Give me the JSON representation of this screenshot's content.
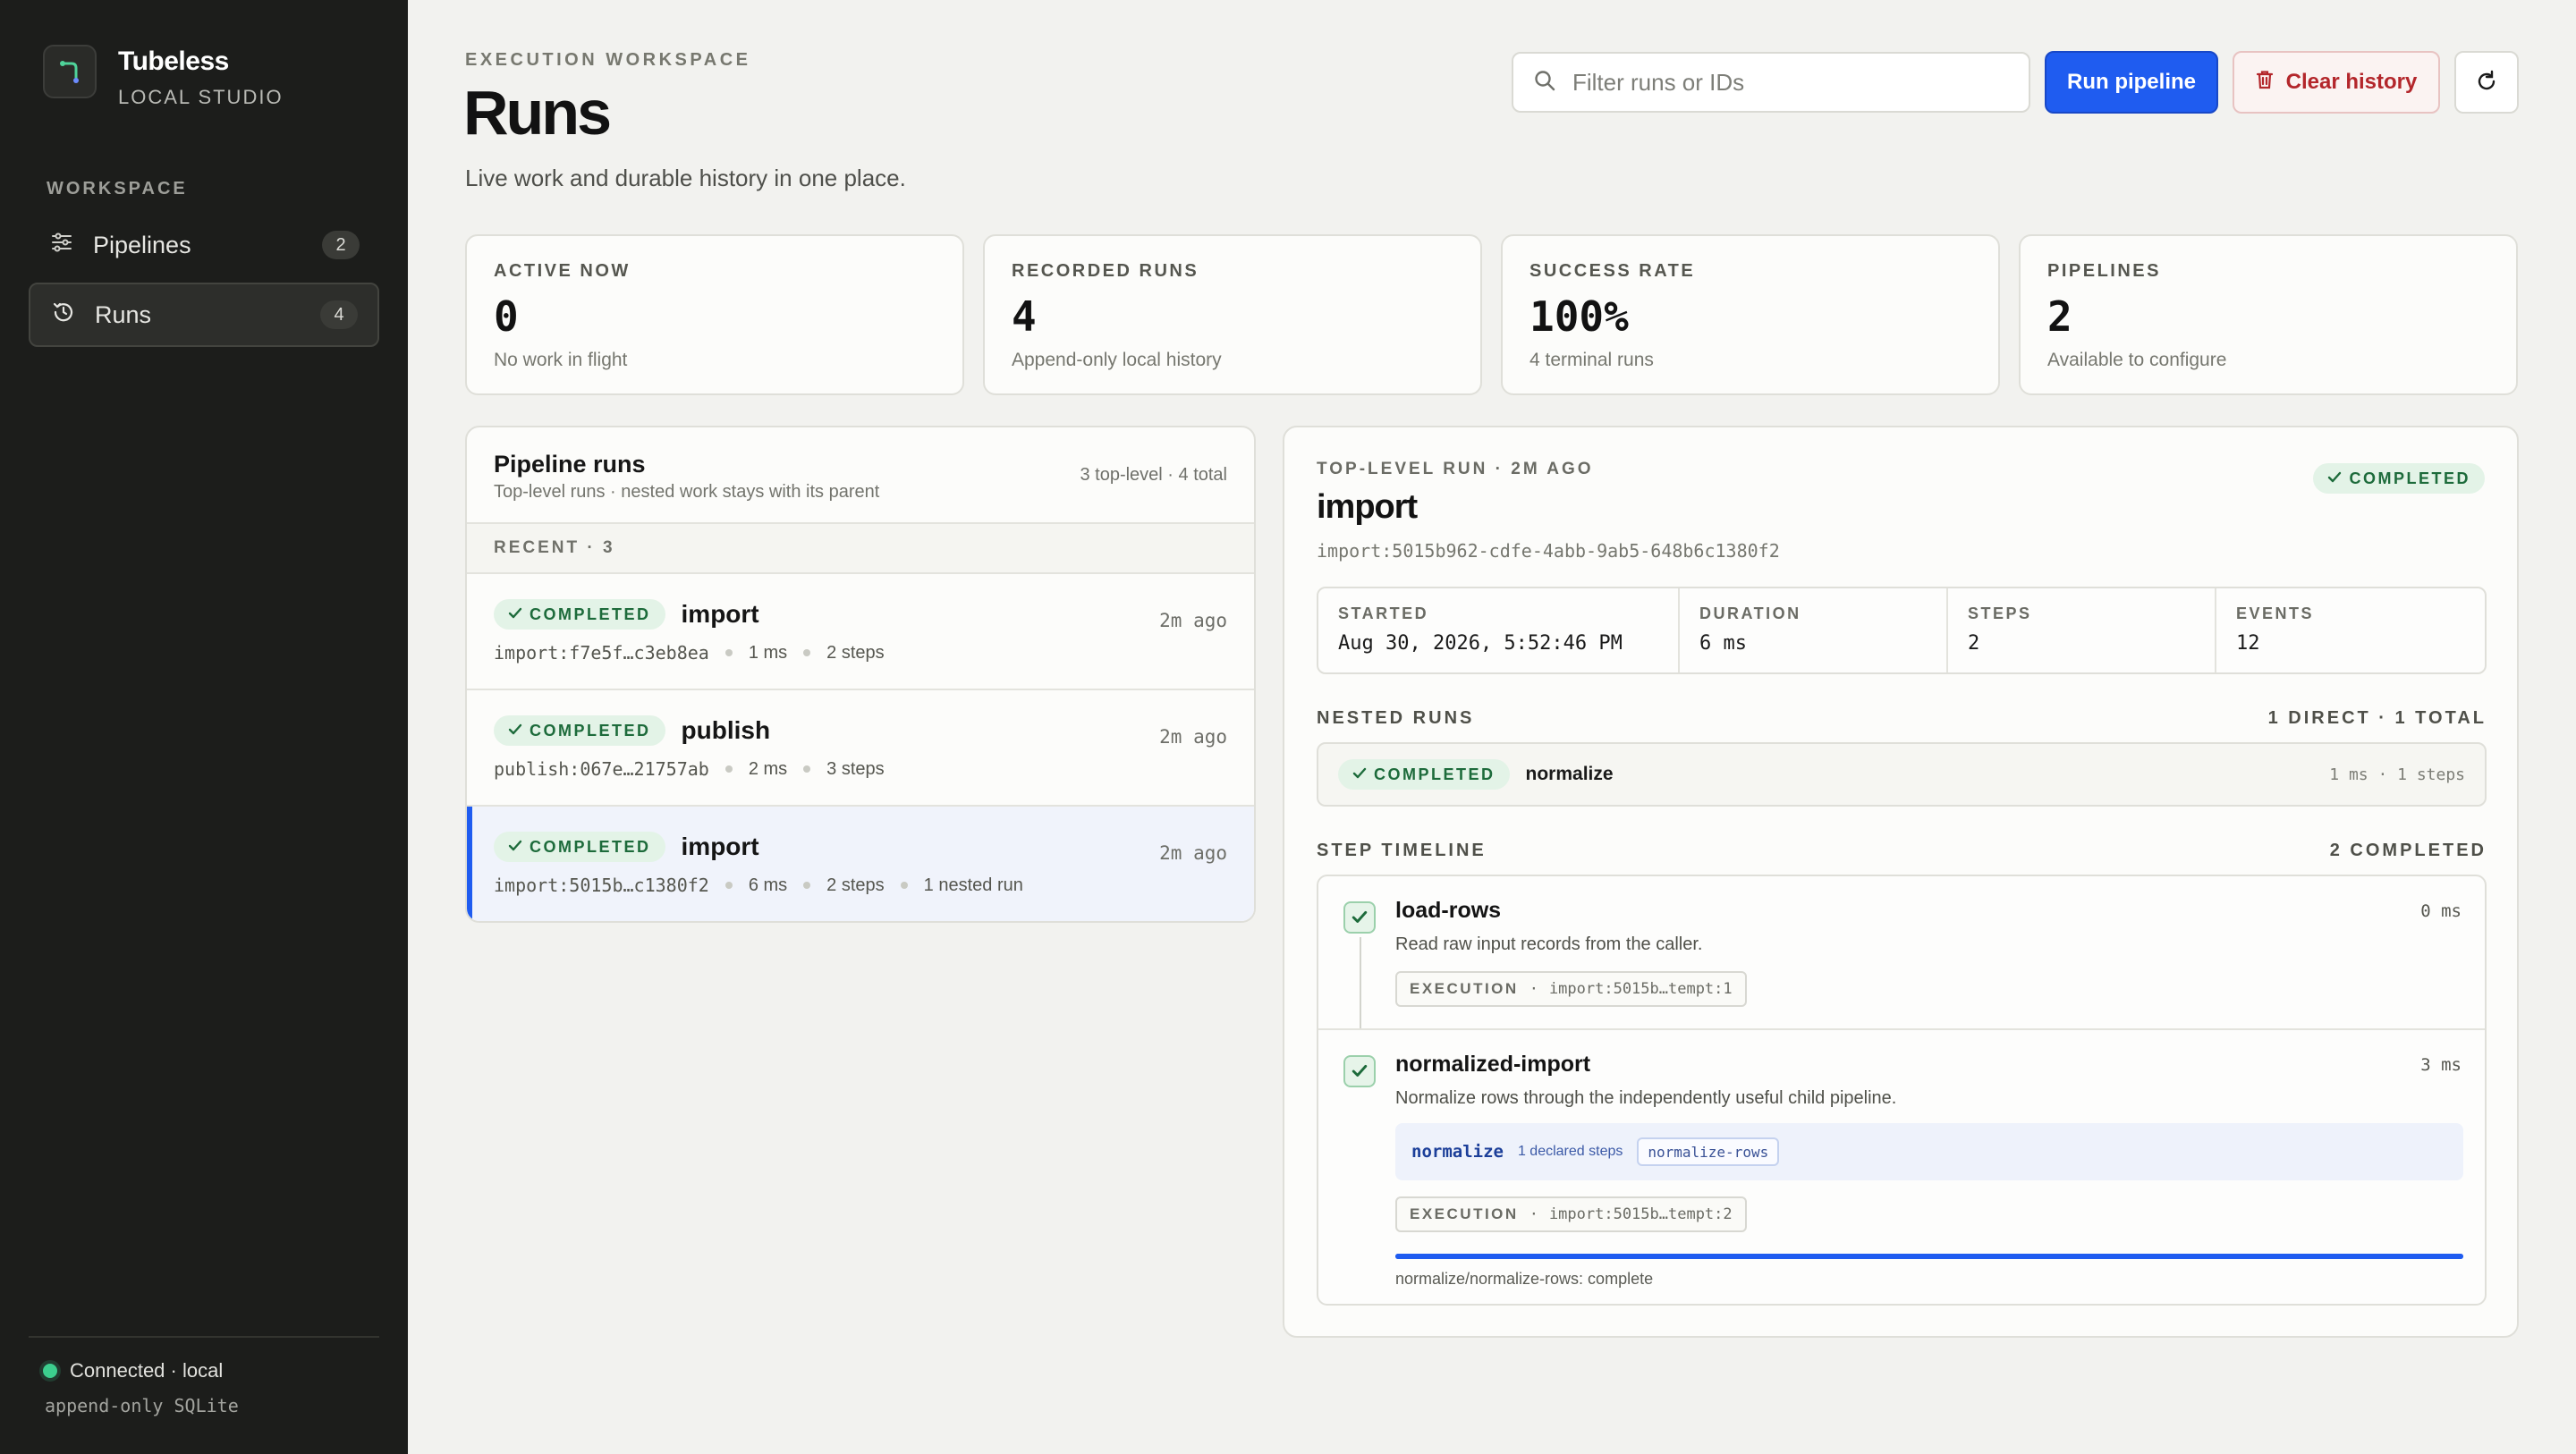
{
  "brand": {
    "name": "Tubeless",
    "subtitle": "LOCAL STUDIO"
  },
  "sidebar": {
    "section_label": "WORKSPACE",
    "items": [
      {
        "label": "Pipelines",
        "count": "2",
        "icon": "sliders-icon"
      },
      {
        "label": "Runs",
        "count": "4",
        "icon": "history-icon",
        "active": true
      }
    ],
    "status": {
      "label": "Connected · local",
      "sub": "append-only SQLite",
      "color": "#3ccf8e"
    }
  },
  "header": {
    "eyebrow": "EXECUTION WORKSPACE",
    "title": "Runs",
    "subtitle": "Live work and durable history in one place."
  },
  "toolbar": {
    "search_placeholder": "Filter runs or IDs",
    "run_label": "Run pipeline",
    "clear_label": "Clear history",
    "accent": "#1f5cf0",
    "danger": "#b3262b"
  },
  "stats": [
    {
      "label": "ACTIVE NOW",
      "value": "0",
      "sub": "No work in flight"
    },
    {
      "label": "RECORDED RUNS",
      "value": "4",
      "sub": "Append-only local history"
    },
    {
      "label": "SUCCESS RATE",
      "value": "100%",
      "sub": "4 terminal runs"
    },
    {
      "label": "PIPELINES",
      "value": "2",
      "sub": "Available to configure"
    }
  ],
  "runs_panel": {
    "title": "Pipeline runs",
    "subtitle": "Top-level runs · nested work stays with its parent",
    "count": "3 top-level · 4 total",
    "recent_label": "RECENT · 3",
    "runs": [
      {
        "status": "COMPLETED",
        "name": "import",
        "ago": "2m ago",
        "id": "import:f7e5f…c3eb8ea",
        "duration": "1 ms",
        "steps": "2 steps",
        "nested": ""
      },
      {
        "status": "COMPLETED",
        "name": "publish",
        "ago": "2m ago",
        "id": "publish:067e…21757ab",
        "duration": "2 ms",
        "steps": "3 steps",
        "nested": ""
      },
      {
        "status": "COMPLETED",
        "name": "import",
        "ago": "2m ago",
        "id": "import:5015b…c1380f2",
        "duration": "6 ms",
        "steps": "2 steps",
        "nested": "1 nested run",
        "selected": true
      }
    ]
  },
  "detail": {
    "eyebrow": "TOP-LEVEL RUN · 2M AGO",
    "status": "COMPLETED",
    "title": "import",
    "id": "import:5015b962-cdfe-4abb-9ab5-648b6c1380f2",
    "facts": [
      {
        "label": "STARTED",
        "value": "Aug 30, 2026, 5:52:46 PM"
      },
      {
        "label": "DURATION",
        "value": "6 ms"
      },
      {
        "label": "STEPS",
        "value": "2"
      },
      {
        "label": "EVENTS",
        "value": "12"
      }
    ],
    "nested": {
      "label": "NESTED RUNS",
      "summary": "1 DIRECT · 1 TOTAL",
      "row": {
        "status": "COMPLETED",
        "name": "normalize",
        "meta": "1 ms · 1 steps"
      }
    },
    "timeline": {
      "label": "STEP TIMELINE",
      "summary": "2 COMPLETED",
      "steps": [
        {
          "name": "load-rows",
          "time": "0 ms",
          "desc": "Read raw input records from the caller.",
          "exec_key": "EXECUTION",
          "exec_id": "import:5015b…tempt:1"
        },
        {
          "name": "normalized-import",
          "time": "3 ms",
          "desc": "Normalize rows through the independently useful child pipeline.",
          "child": {
            "name": "normalize",
            "steps": "1 declared steps",
            "chip": "normalize-rows"
          },
          "exec_key": "EXECUTION",
          "exec_id": "import:5015b…tempt:2",
          "progress": 1.0,
          "progress_label": "normalize/normalize-rows: complete"
        }
      ]
    }
  }
}
